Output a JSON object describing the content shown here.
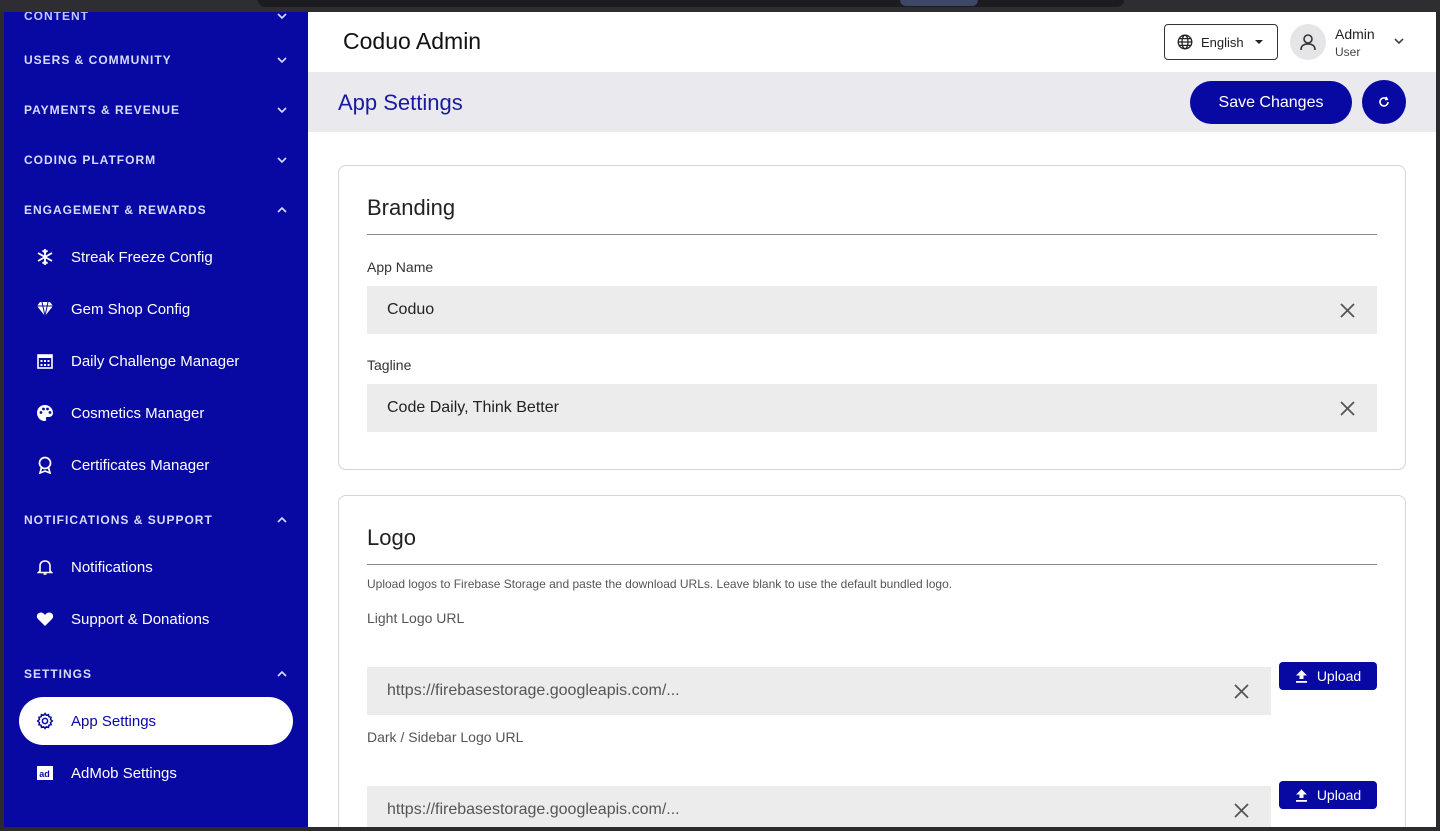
{
  "sidebar": {
    "sections": [
      {
        "label": "USERS & COMMUNITY",
        "expanded": false
      },
      {
        "label": "PAYMENTS & REVENUE",
        "expanded": false
      },
      {
        "label": "CODING PLATFORM",
        "expanded": false
      },
      {
        "label": "ENGAGEMENT & REWARDS",
        "expanded": true
      },
      {
        "label": "NOTIFICATIONS & SUPPORT",
        "expanded": true
      },
      {
        "label": "SETTINGS",
        "expanded": true
      }
    ],
    "items": [
      {
        "label": "Streak Freeze Config",
        "icon": "snowflake-icon"
      },
      {
        "label": "Gem Shop Config",
        "icon": "diamond-icon"
      },
      {
        "label": "Daily Challenge Manager",
        "icon": "calendar-icon"
      },
      {
        "label": "Cosmetics Manager",
        "icon": "palette-icon"
      },
      {
        "label": "Certificates Manager",
        "icon": "award-icon"
      },
      {
        "label": "Notifications",
        "icon": "bell-icon"
      },
      {
        "label": "Support & Donations",
        "icon": "heart-icon"
      },
      {
        "label": "App Settings",
        "icon": "gear-icon",
        "active": true
      },
      {
        "label": "AdMob Settings",
        "icon": "ad-icon"
      }
    ]
  },
  "header": {
    "title": "Coduo Admin",
    "language": "English",
    "user_name": "Admin",
    "user_role": "User"
  },
  "subheader": {
    "title": "App Settings",
    "save_label": "Save Changes"
  },
  "branding": {
    "title": "Branding",
    "app_name_label": "App Name",
    "app_name_value": "Coduo",
    "tagline_label": "Tagline",
    "tagline_value": "Code Daily, Think Better"
  },
  "logo": {
    "title": "Logo",
    "help": "Upload logos to Firebase Storage and paste the download URLs. Leave blank to use the default bundled logo.",
    "light_label": "Light Logo URL",
    "light_value": "https://firebasestorage.googleapis.com/...",
    "dark_label": "Dark / Sidebar Logo URL",
    "dark_value": "https://firebasestorage.googleapis.com/...",
    "upload_label": "Upload"
  },
  "colors": {
    "brand": "#0808a3",
    "background": "#ffffff",
    "subheader_bg": "#e9e9ee",
    "field_bg": "#ececec"
  }
}
